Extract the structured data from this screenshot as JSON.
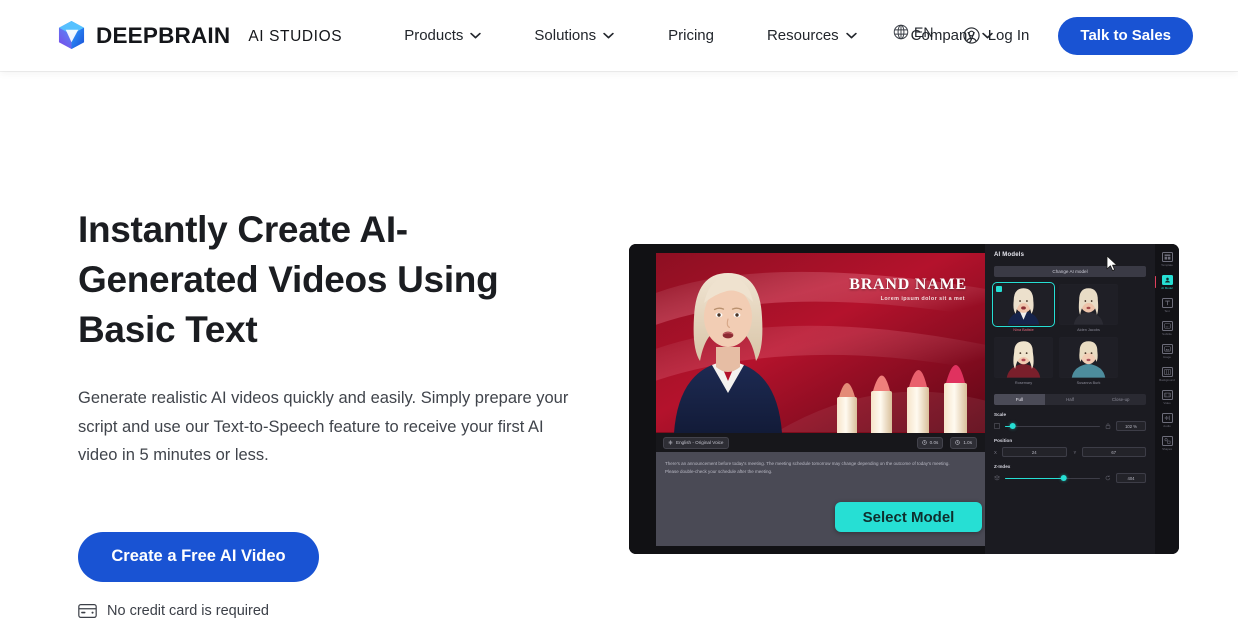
{
  "header": {
    "brand_name": "DEEPBRAIN",
    "brand_sub": "AI STUDIOS",
    "logo_icon": "cube-logo-icon",
    "nav": [
      {
        "label": "Products",
        "has_caret": true
      },
      {
        "label": "Solutions",
        "has_caret": true
      },
      {
        "label": "Pricing",
        "has_caret": false
      },
      {
        "label": "Resources",
        "has_caret": true
      },
      {
        "label": "Company",
        "has_caret": true
      }
    ],
    "language": {
      "label": "EN",
      "icon": "globe-icon"
    },
    "login": {
      "label": "Log In",
      "icon": "user-circle-icon"
    },
    "cta": {
      "label": "Talk to Sales"
    }
  },
  "hero": {
    "title_line1": "Instantly Create AI-",
    "title_line2": "Generated Videos Using",
    "title_line3": "Basic Text",
    "subtitle": "Generate realistic AI videos quickly and easily. Simply prepare your script and use our Text-to-Speech feature to receive your first AI video in 5 minutes or less.",
    "cta_label": "Create a Free AI Video",
    "note_label": "No credit card is required",
    "note_icon": "credit-card-icon"
  },
  "mockup": {
    "stage": {
      "brand_title": "BRAND NAME",
      "brand_sub": "Lorem ipsum dolor sit a met"
    },
    "toolbar": {
      "language_chip": "English - Original Voice",
      "language_icon": "voice-icon",
      "start_time": "0.0s",
      "end_time": "1.0s",
      "clock_icon": "clock-icon"
    },
    "script_text": "There's an announcement before today's meeting. The meeting schedule tomorrow may change depending on the outcome of today's meeting. Please double-check your schedule after the meeting.",
    "select_model_label": "Select Model",
    "panel": {
      "heading": "AI Models",
      "change_button": "Change AI model",
      "models": [
        {
          "name": "Nina Batiste",
          "selected": true
        },
        {
          "name": "Aiden Jacobs",
          "selected": false
        },
        {
          "name": "Rosemary",
          "selected": false
        },
        {
          "name": "Susanna Burk",
          "selected": false
        }
      ],
      "segments": [
        {
          "label": "Full",
          "active": true
        },
        {
          "label": "Half",
          "active": false
        },
        {
          "label": "Close-up",
          "active": false
        }
      ],
      "scale": {
        "label": "Scale",
        "value": "102 %",
        "percent": 8
      },
      "position": {
        "label": "Position",
        "x_key": "X",
        "x_value": "24",
        "y_key": "Y",
        "y_value": "67"
      },
      "zindex": {
        "label": "Z-Index",
        "value": "404",
        "percent": 62
      }
    },
    "rail": [
      {
        "label": "Template",
        "icon": "template-icon",
        "active": false
      },
      {
        "label": "AI Model",
        "icon": "ai-model-icon",
        "active": true
      },
      {
        "label": "Text",
        "icon": "text-icon",
        "active": false
      },
      {
        "label": "Subtitle",
        "icon": "subtitle-icon",
        "active": false
      },
      {
        "label": "Image",
        "icon": "image-icon",
        "active": false
      },
      {
        "label": "Background",
        "icon": "background-icon",
        "active": false
      },
      {
        "label": "Video",
        "icon": "video-icon",
        "active": false
      },
      {
        "label": "Audio",
        "icon": "audio-icon",
        "active": false
      },
      {
        "label": "Shapes",
        "icon": "shapes-icon",
        "active": false
      }
    ]
  },
  "colors": {
    "brand_blue": "#1953d3",
    "accent_teal": "#26dfd4",
    "text_dark": "#1b1d21"
  }
}
